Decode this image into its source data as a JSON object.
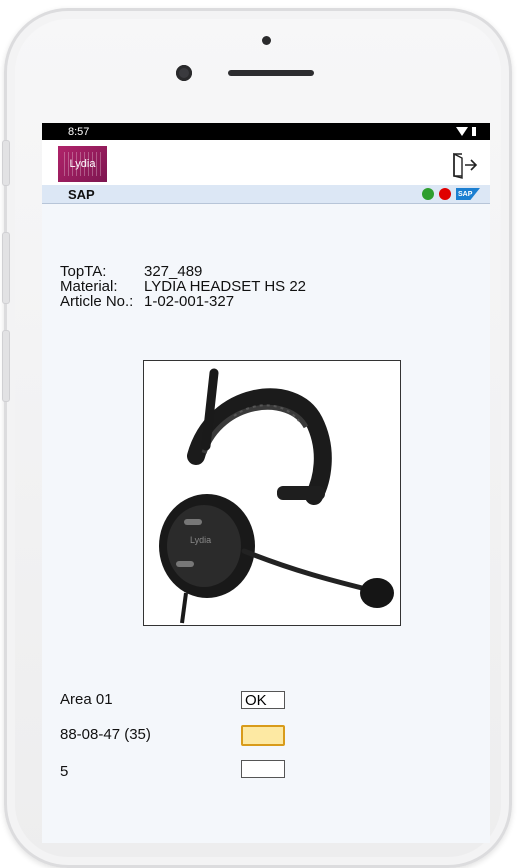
{
  "status_bar": {
    "time": "8:57"
  },
  "header": {
    "logo_text": "Lydia",
    "logout_icon": "logout-icon"
  },
  "sap_bar": {
    "label": "SAP",
    "indicators": [
      {
        "name": "status-green",
        "color": "#2e9e2e"
      },
      {
        "name": "status-red",
        "color": "#e00000"
      }
    ],
    "sap_logo_text": "SAP"
  },
  "info": {
    "rows": [
      {
        "key": "TopTA:",
        "value": "327_489"
      },
      {
        "key": "Material:",
        "value": "LYDIA HEADSET HS 22"
      },
      {
        "key": "Article No.:",
        "value": "1-02-001-327"
      }
    ]
  },
  "product_image": {
    "subject": "headset",
    "brand_text": "Lydia"
  },
  "fields": [
    {
      "label": "Area 01",
      "value": "OK"
    },
    {
      "label": "88-08-47 (35)",
      "value": ""
    },
    {
      "label": "5",
      "value": ""
    }
  ],
  "colors": {
    "accent": "#b0236a",
    "focus_border": "#d89b1a",
    "focus_fill": "#fde9a3",
    "sap_bar": "#dce7f5"
  }
}
